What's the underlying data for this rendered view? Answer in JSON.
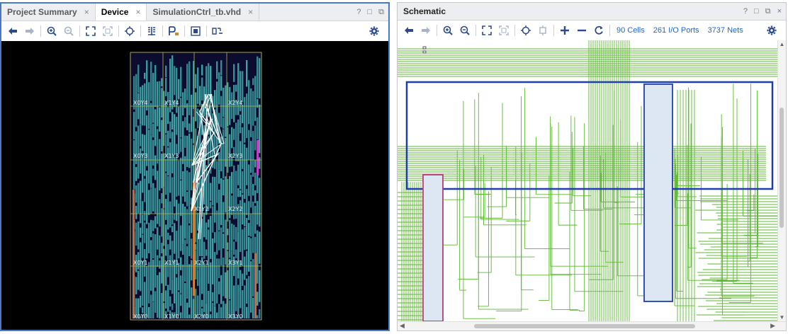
{
  "left_panel": {
    "tabs": [
      {
        "label": "Project Summary",
        "active": false
      },
      {
        "label": "Device",
        "active": true
      },
      {
        "label": "SimulationCtrl_tb.vhd",
        "active": false
      }
    ],
    "window_controls": [
      "?",
      "□",
      "⧉"
    ],
    "toolbar_icons": [
      "back-arrow-icon",
      "forward-arrow-icon",
      "zoom-in-icon",
      "zoom-out-icon",
      "zoom-fit-icon",
      "zoom-selection-icon",
      "auto-fit-icon",
      "routing-resources-icon",
      "pblock-icon",
      "select-area-icon",
      "fixed-icon",
      "settings-gear-icon"
    ],
    "region_labels": [
      "X0Y4",
      "X1Y4",
      "X2Y4",
      "X0Y3",
      "X1Y3",
      "X2Y3",
      "X1Y2",
      "X2Y2",
      "X0Y1",
      "X1Y1",
      "X2Y1",
      "X3Y1",
      "X0Y0",
      "X1Y0",
      "X2Y0",
      "X3Y0"
    ]
  },
  "right_panel": {
    "title": "Schematic",
    "window_controls": [
      "?",
      "□",
      "⧉",
      "×"
    ],
    "stats": {
      "cells": "90 Cells",
      "io_ports": "261 I/O Ports",
      "nets": "3737 Nets"
    }
  },
  "colors": {
    "device_logic": "#3fa7a7",
    "route_green": "#5cb832",
    "block_blue": "#1f3fae",
    "block_fill": "#dde6f3",
    "block_pink": "#c0397a",
    "link_blue": "#1f66c9",
    "active_border": "#4a78c2"
  }
}
